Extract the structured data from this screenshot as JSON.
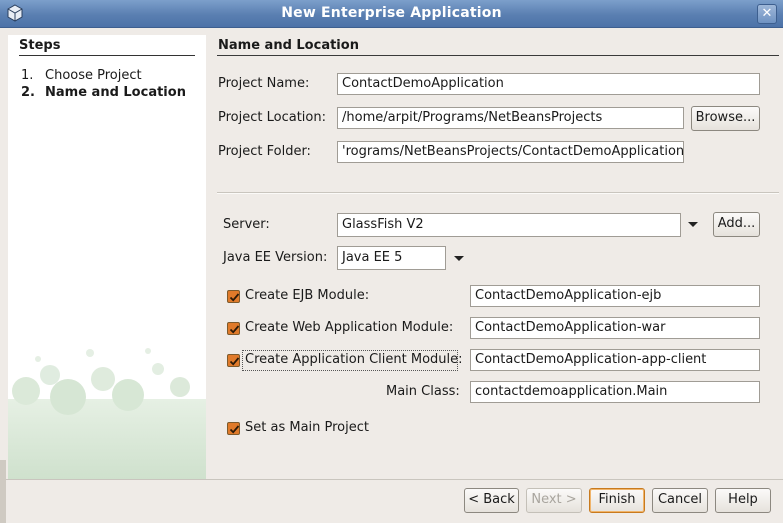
{
  "window": {
    "title": "New Enterprise Application"
  },
  "steps": {
    "title": "Steps",
    "items": [
      {
        "num": "1.",
        "label": "Choose Project"
      },
      {
        "num": "2.",
        "label": "Name and Location"
      }
    ]
  },
  "section": {
    "title": "Name and Location"
  },
  "project": {
    "name_label": "Project Name:",
    "name_value": "ContactDemoApplication",
    "location_label": "Project Location:",
    "location_value": "/home/arpit/Programs/NetBeansProjects",
    "browse_label": "Browse...",
    "folder_label": "Project Folder:",
    "folder_value": "/home/arpit/Programs/NetBeansProjects/ContactDemoApplication",
    "folder_visible": "'rograms/NetBeansProjects/ContactDemoApplication"
  },
  "server": {
    "label": "Server:",
    "value": "GlassFish V2",
    "add_label": "Add..."
  },
  "javaee": {
    "label": "Java EE Version:",
    "value": "Java EE 5"
  },
  "modules": {
    "ejb_label": "Create EJB Module:",
    "ejb_value": "ContactDemoApplication-ejb",
    "web_label": "Create Web Application Module:",
    "web_value": "ContactDemoApplication-war",
    "client_label": "Create Application Client Module:",
    "client_value": "ContactDemoApplication-app-client",
    "main_class_label": "Main Class:",
    "main_class_value": "contactdemoapplication.Main",
    "main_project_label": "Set as Main Project"
  },
  "buttons": {
    "back": "< Back",
    "next": "Next >",
    "finish": "Finish",
    "cancel": "Cancel",
    "help": "Help"
  },
  "colors": {
    "titlebar": "#5a7fb1",
    "checkbox": "#e07a2a",
    "dialog_bg": "#efebe7"
  }
}
